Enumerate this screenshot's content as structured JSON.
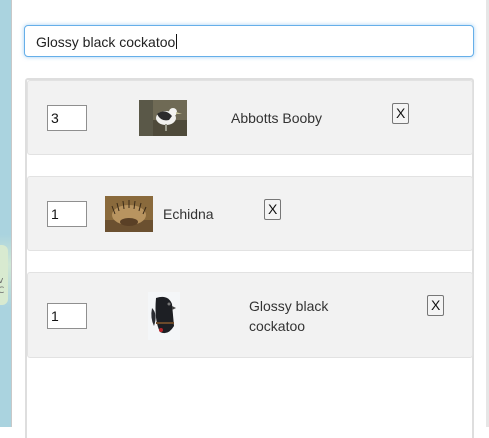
{
  "search": {
    "value": "Glossy black cockatoo"
  },
  "map": {
    "partial_label": "v C"
  },
  "items": [
    {
      "quantity": "3",
      "name": "Abbotts Booby",
      "remove_label": "X",
      "thumbnail": "abbotts-booby-photo"
    },
    {
      "quantity": "1",
      "name": "Echidna",
      "remove_label": "X",
      "thumbnail": "echidna-photo"
    },
    {
      "quantity": "1",
      "name": "Glossy black cockatoo",
      "remove_label": "X",
      "thumbnail": "glossy-black-cockatoo-photo"
    }
  ],
  "colors": {
    "focus_border": "#66afe9",
    "item_background": "#f2f2f2"
  }
}
